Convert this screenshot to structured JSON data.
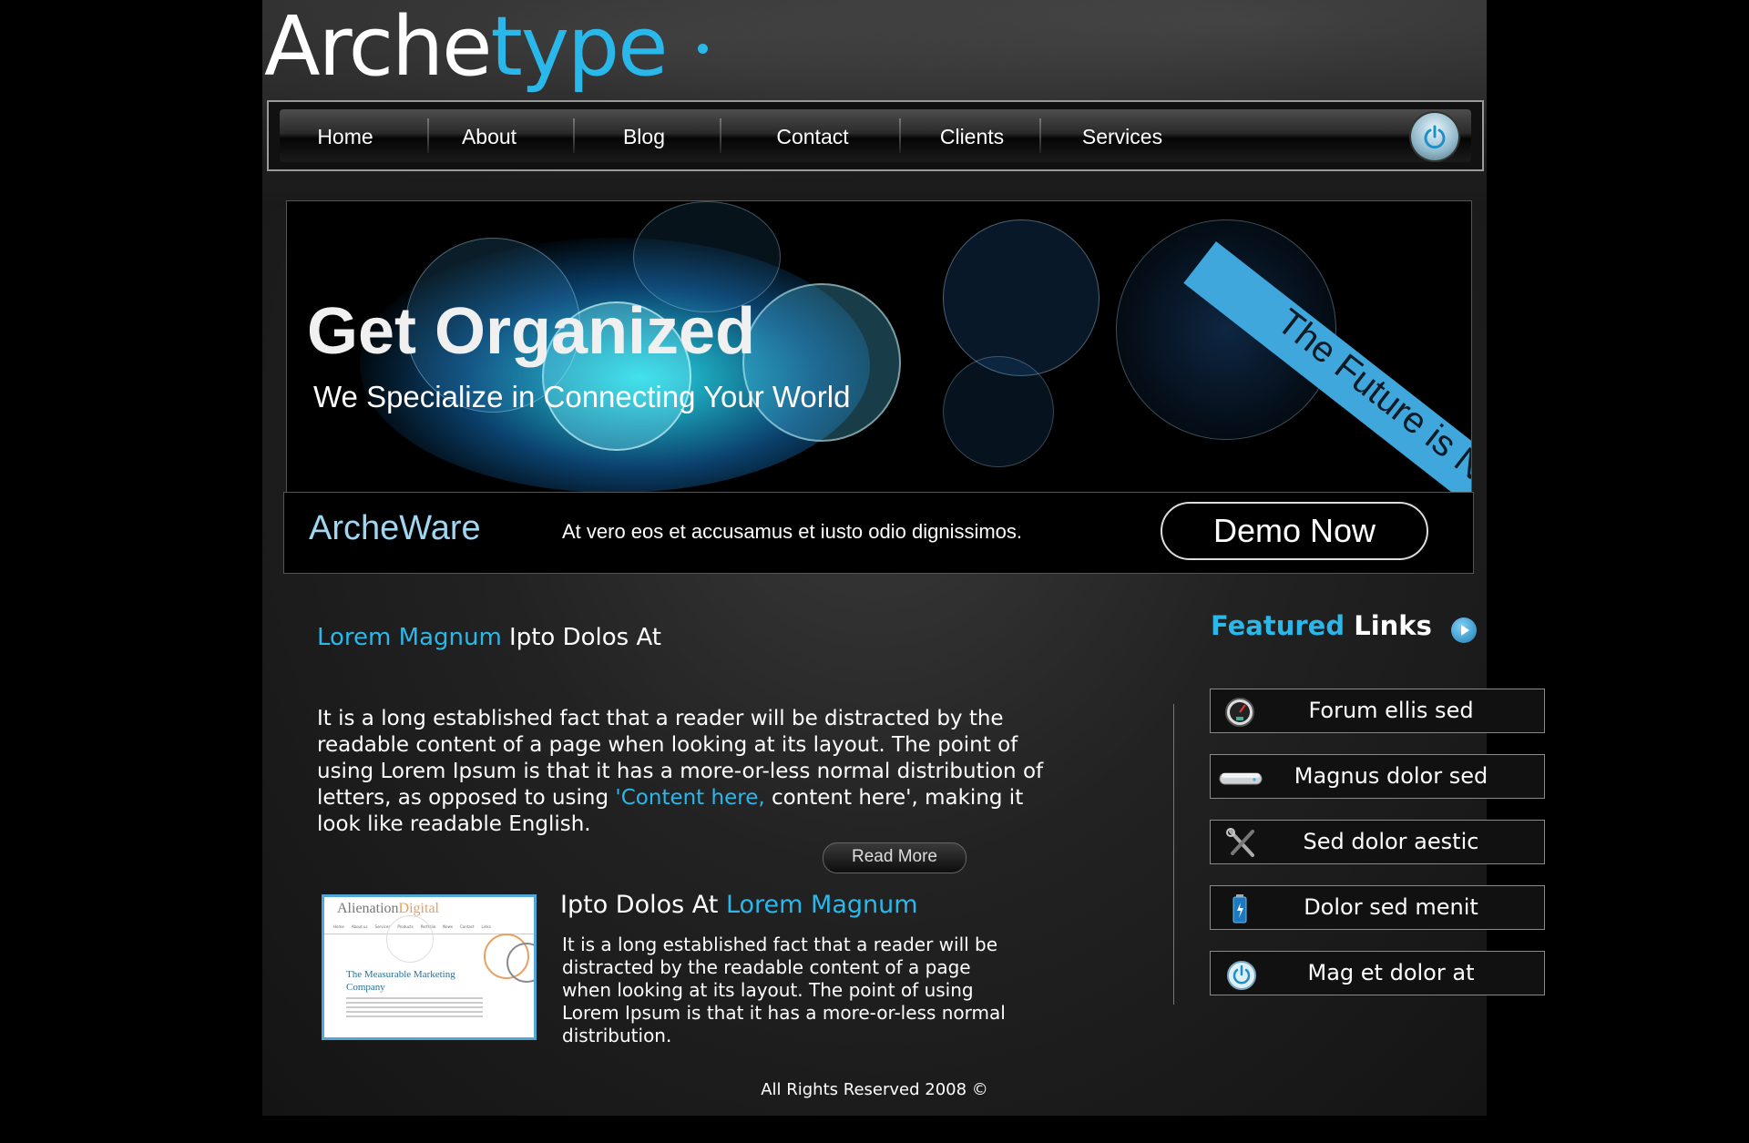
{
  "logo": {
    "part1": "Arche",
    "part2": "type"
  },
  "nav": {
    "items": [
      "Home",
      "About",
      "Blog",
      "Contact",
      "Clients",
      "Services"
    ]
  },
  "hero": {
    "title": "Get Organized",
    "subtitle": "We Specialize in Connecting Your World",
    "ribbon": "The Future is Now"
  },
  "demo": {
    "brand": "ArcheWare",
    "text": "At vero eos et accusamus et iusto odio dignissimos.",
    "button": "Demo Now"
  },
  "main": {
    "title_blue": "Lorem Magnum",
    "title_white": " Ipto Dolos At",
    "para_before": "It is a long established fact that a reader will be distracted by the readable content of a page when looking at its layout. The point of using Lorem Ipsum is that it has a more-or-less normal distribution of letters, as opposed to using ",
    "para_link": "'Content here,",
    "para_after": " content here', making it look like readable English.",
    "read_more": "Read More",
    "sub_title_white": "Ipto Dolos At ",
    "sub_title_blue": "Lorem Magnum",
    "sub_para": "It is a long established fact that a reader will be distracted by the readable content of a page when looking at its layout. The point of using Lorem Ipsum is that it has a more-or-less normal distribution.",
    "thumb": {
      "brand": "Alienation",
      "brand2": "Digital",
      "heading": "The Measurable Marketing Company",
      "nav": [
        "Home",
        "About us",
        "Services",
        "Products",
        "Portfolio",
        "News",
        "Contact",
        "Links"
      ]
    }
  },
  "featured": {
    "title_blue": "Featured",
    "title_white": " Links",
    "links": [
      {
        "label": "Forum ellis sed",
        "icon": "gauge-icon"
      },
      {
        "label": "Magnus dolor sed",
        "icon": "drive-icon"
      },
      {
        "label": "Sed dolor aestic",
        "icon": "tools-icon"
      },
      {
        "label": "Dolor sed menit",
        "icon": "battery-icon"
      },
      {
        "label": "Mag et dolor at",
        "icon": "power-icon"
      }
    ]
  },
  "footer": "All Rights Reserved 2008 ©"
}
